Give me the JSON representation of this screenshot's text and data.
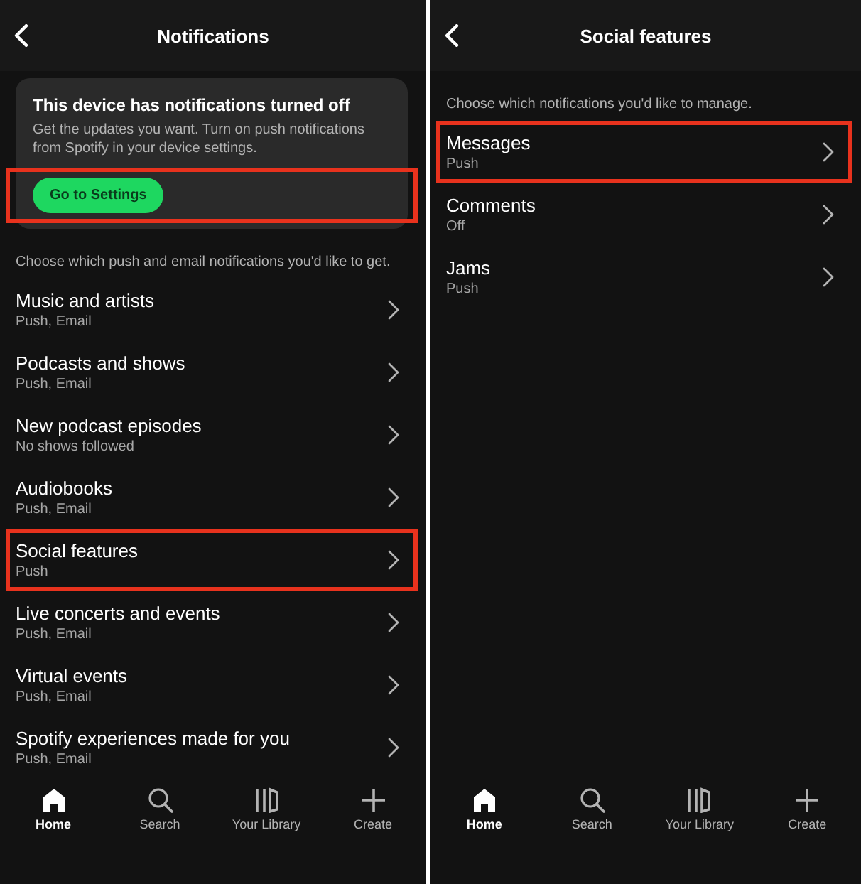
{
  "screens": [
    {
      "title": "Notifications",
      "banner": {
        "title": "This device has notifications turned off",
        "text": "Get the updates you want. Turn on push notifications from Spotify in your device settings.",
        "button": "Go to Settings",
        "highlighted": true
      },
      "intro": "Choose which push and email notifications you'd like to get.",
      "rows": [
        {
          "label": "Music and artists",
          "value": "Push, Email",
          "highlighted": false
        },
        {
          "label": "Podcasts and shows",
          "value": "Push, Email",
          "highlighted": false
        },
        {
          "label": "New podcast episodes",
          "value": "No shows followed",
          "highlighted": false
        },
        {
          "label": "Audiobooks",
          "value": "Push, Email",
          "highlighted": false
        },
        {
          "label": "Social features",
          "value": "Push",
          "highlighted": true
        },
        {
          "label": "Live concerts and events",
          "value": "Push, Email",
          "highlighted": false
        },
        {
          "label": "Virtual events",
          "value": "Push, Email",
          "highlighted": false
        },
        {
          "label": "Spotify experiences made for you",
          "value": "Push, Email",
          "highlighted": false
        }
      ],
      "nav": [
        {
          "label": "Home",
          "selected": true
        },
        {
          "label": "Search",
          "selected": false
        },
        {
          "label": "Your Library",
          "selected": false
        },
        {
          "label": "Create",
          "selected": false
        }
      ]
    },
    {
      "title": "Social features",
      "intro": "Choose which notifications you'd like to manage.",
      "rows": [
        {
          "label": "Messages",
          "value": "Push",
          "highlighted": true
        },
        {
          "label": "Comments",
          "value": "Off",
          "highlighted": false
        },
        {
          "label": "Jams",
          "value": "Push",
          "highlighted": false
        }
      ],
      "nav": [
        {
          "label": "Home",
          "selected": true
        },
        {
          "label": "Search",
          "selected": false
        },
        {
          "label": "Your Library",
          "selected": false
        },
        {
          "label": "Create",
          "selected": false
        }
      ]
    }
  ]
}
